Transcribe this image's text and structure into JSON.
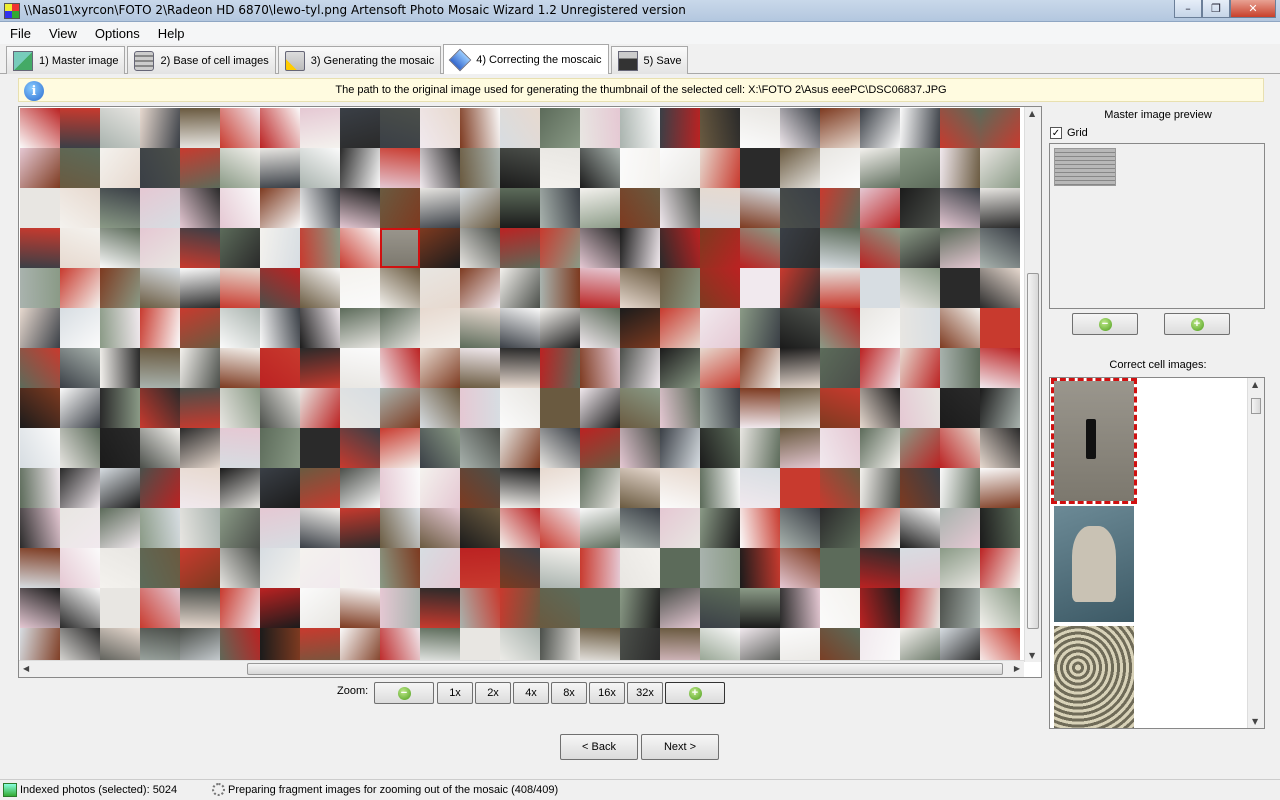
{
  "window": {
    "title": "\\\\Nas01\\xyrcon\\FOTO 2\\Radeon HD 6870\\lewo-tyl.png Artensoft Photo Mosaic Wizard 1.2  Unregistered version",
    "minimize": "–",
    "maximize": "❐",
    "close": "✕"
  },
  "menu": [
    "File",
    "View",
    "Options",
    "Help"
  ],
  "tabs": [
    {
      "label": "1) Master image",
      "icon": "picture-icon"
    },
    {
      "label": "2) Base of cell images",
      "icon": "database-add-icon"
    },
    {
      "label": "3) Generating the mosaic",
      "icon": "magic-wand-icon"
    },
    {
      "label": "4) Correcting the moscaic",
      "icon": "cube-icon"
    },
    {
      "label": "5) Save",
      "icon": "floppy-disk-icon"
    }
  ],
  "info": {
    "icon": "info-icon",
    "text": "The path to the original image used for generating the thumbnail of the selected cell: X:\\FOTO 2\\Asus eeePC\\DSC06837.JPG"
  },
  "zoom": {
    "label": "Zoom:",
    "levels": [
      "1x",
      "2x",
      "4x",
      "8x",
      "16x",
      "32x"
    ],
    "minus_icon": "minus-icon",
    "plus_icon": "plus-icon"
  },
  "preview": {
    "label": "Master image preview",
    "grid_label": "Grid",
    "grid_checked": true
  },
  "correct": {
    "label": "Correct cell images:"
  },
  "nav": {
    "back": "< Back",
    "next": "Next >"
  },
  "status": {
    "indexed": "Indexed photos (selected): 5024",
    "progress": "Preparing fragment images for zooming out of the mosaic (408/409)"
  },
  "colors": {
    "selection": "#d01010",
    "info_bg": "#fffbe0"
  }
}
